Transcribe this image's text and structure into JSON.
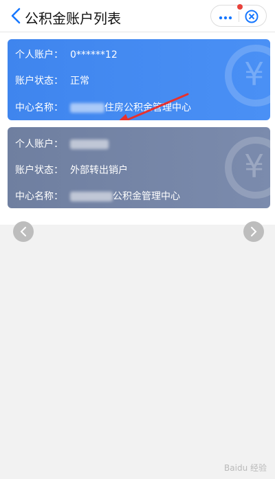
{
  "header": {
    "title": "公积金账户列表",
    "icons": {
      "back": "chevron-left-icon",
      "more": "more-dots-icon",
      "close": "close-circle-icon"
    },
    "colors": {
      "accent": "#1677ff",
      "badge": "#e8413a"
    }
  },
  "accounts": [
    {
      "personal_label": "个人账户：",
      "personal_value": "0******12",
      "status_label": "账户状态：",
      "status_value": "正常",
      "center_label": "中心名称：",
      "center_value": "住房公积金管理中心",
      "color": "#4a8ef2"
    },
    {
      "personal_label": "个人账户：",
      "personal_value": "",
      "status_label": "账户状态：",
      "status_value": "外部转出销户",
      "center_label": "中心名称：",
      "center_value": "公积金管理中心",
      "color": "#7383a5"
    }
  ],
  "nav": {
    "prev_icon": "chevron-left-icon",
    "next_icon": "chevron-right-icon"
  },
  "watermark": "Baidu 经验"
}
